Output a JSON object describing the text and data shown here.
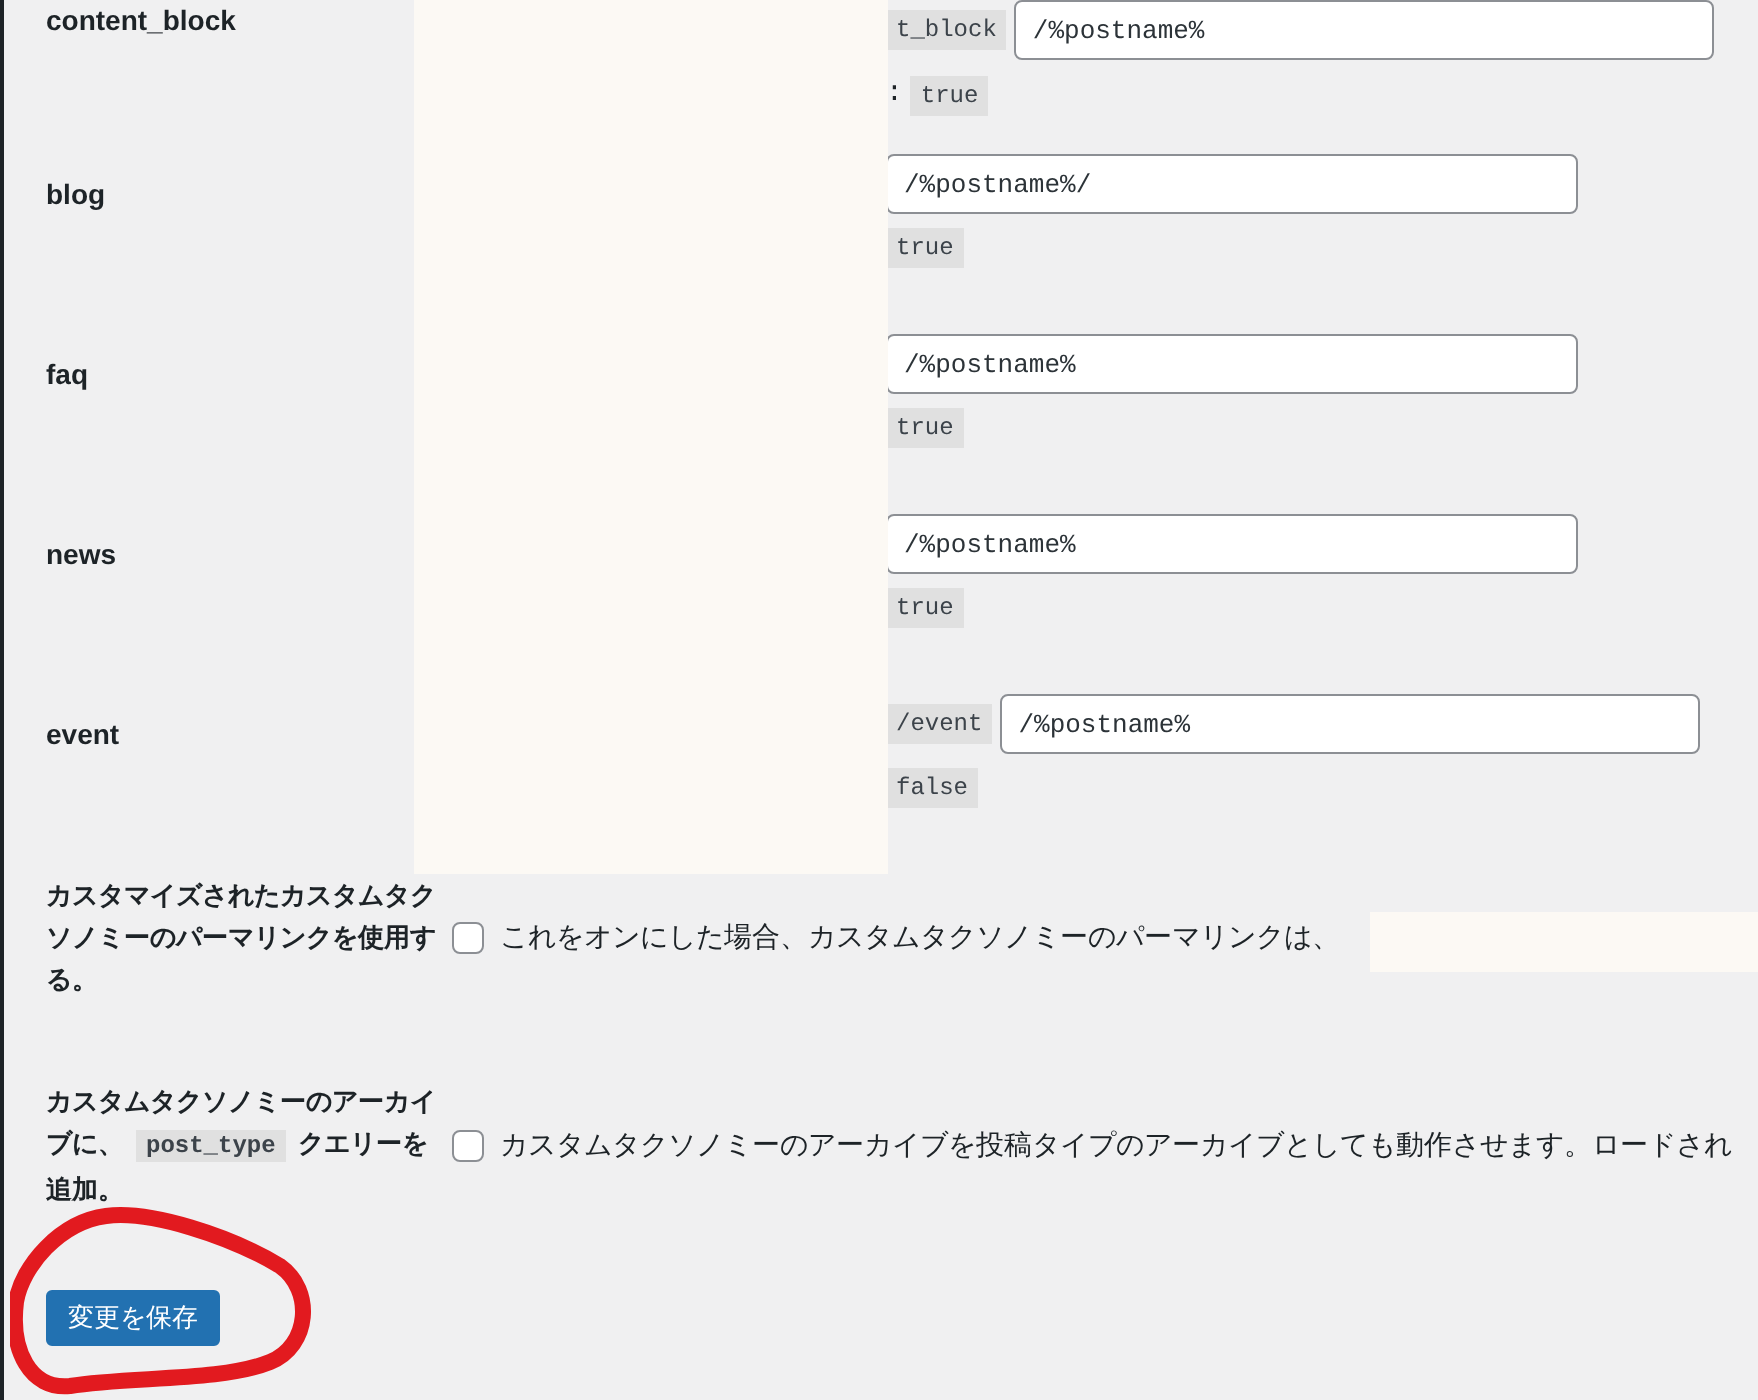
{
  "post_types": [
    {
      "name": "content_block",
      "prefix": "t_block",
      "structure": "/%postname%",
      "with_front_sep": ":",
      "with_front": "true"
    },
    {
      "name": "blog",
      "structure": "/%postname%/",
      "with_front": "true"
    },
    {
      "name": "faq",
      "structure": "/%postname%",
      "with_front": "true"
    },
    {
      "name": "news",
      "structure": "/%postname%",
      "with_front": "true"
    },
    {
      "name": "event",
      "prefix": "/event",
      "structure": "/%postname%",
      "with_front": "false"
    }
  ],
  "options": [
    {
      "label_before": "カスタマイズされたカスタムタクソノミーのパーマリンクを使用する。",
      "checked": false,
      "description": "これをオンにした場合、カスタムタクソノミーのパーマリンクは、"
    },
    {
      "label_before": "カスタムタクソノミーのアーカイブに、",
      "label_code": "post_type",
      "label_after": "クエリーを追加。",
      "checked": false,
      "description": "カスタムタクソノミーのアーカイブを投稿タイプのアーカイブとしても動作させます。ロードされ"
    }
  ],
  "save_button": "変更を保存"
}
